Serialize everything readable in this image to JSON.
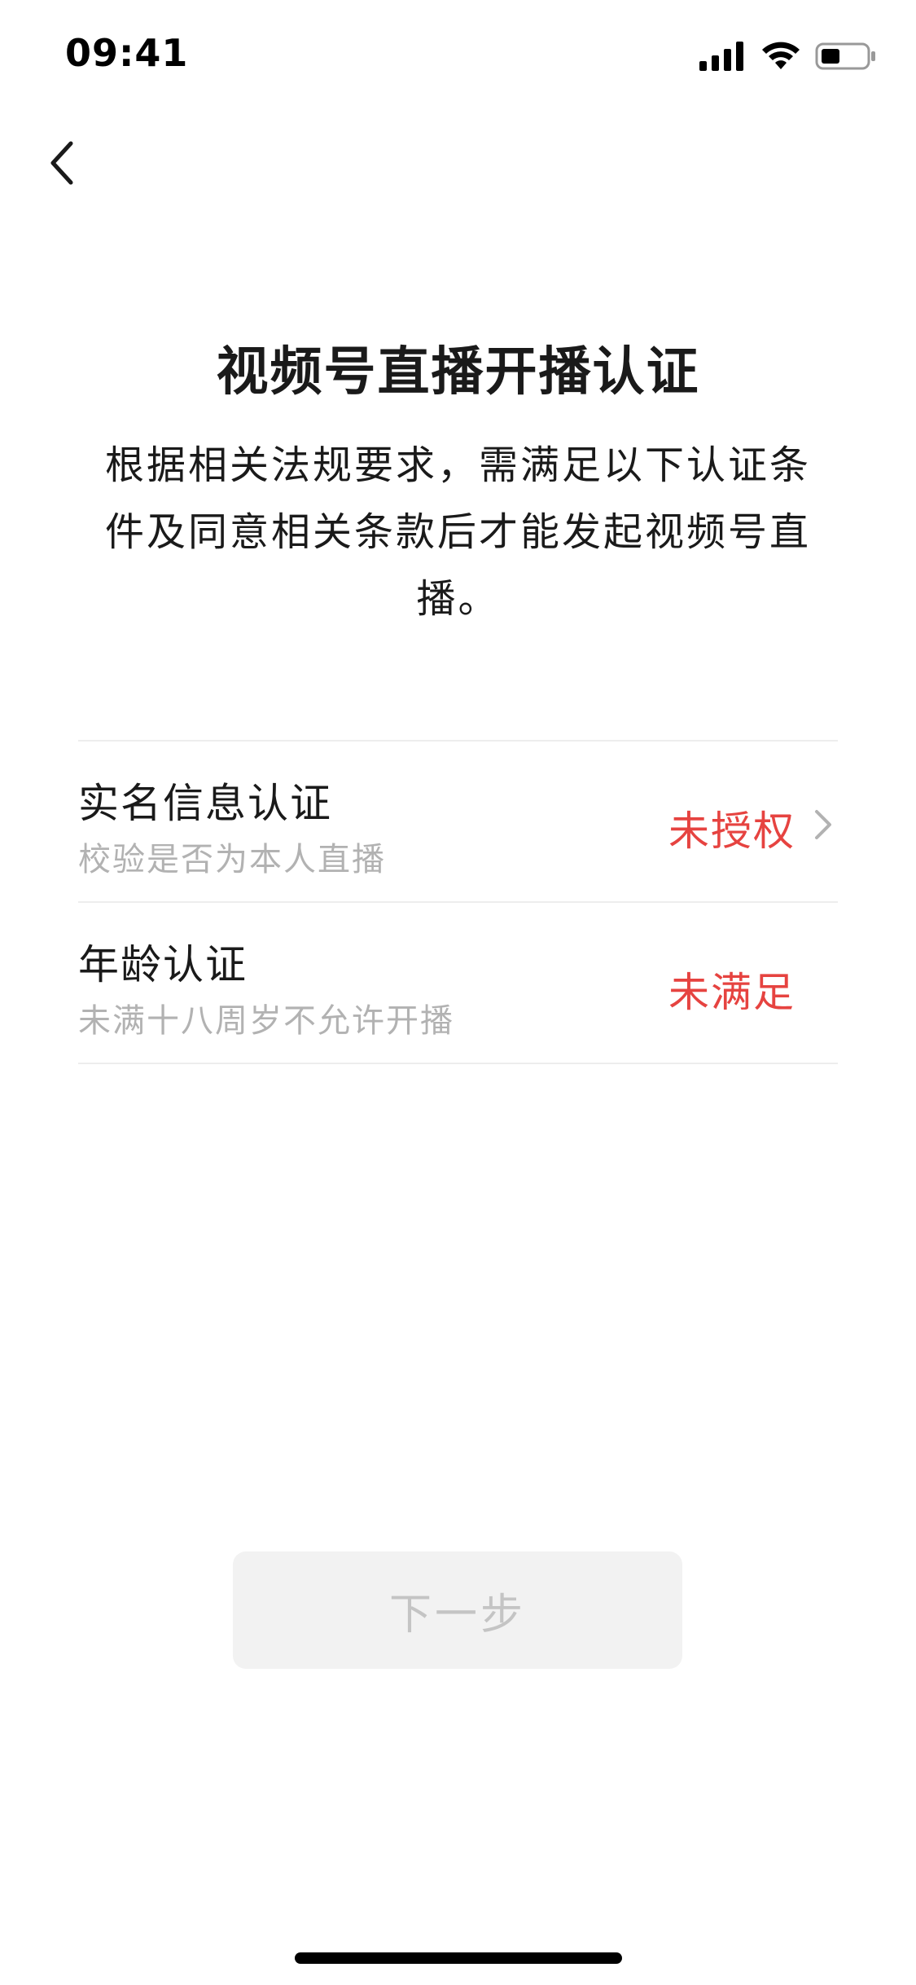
{
  "status_bar": {
    "time": "09:41",
    "icons": [
      "signal-icon",
      "wifi-icon",
      "battery-icon"
    ]
  },
  "nav": {
    "back_icon": "back-arrow-icon"
  },
  "page": {
    "title": "视频号直播开播认证",
    "description": "根据相关法规要求，需满足以下认证条件及同意相关条款后才能发起视频号直播。"
  },
  "cert_items": [
    {
      "title": "实名信息认证",
      "subtitle": "校验是否为本人直播",
      "status": "未授权",
      "has_chevron": true
    },
    {
      "title": "年龄认证",
      "subtitle": "未满十八周岁不允许开播",
      "status": "未满足",
      "has_chevron": false
    }
  ],
  "actions": {
    "next_label": "下一步"
  },
  "colors": {
    "warning": "#e64340",
    "subtitle": "#b2b2b2",
    "button_bg": "#f2f2f2",
    "button_text_disabled": "#c4c4c4",
    "divider": "#ededed"
  }
}
